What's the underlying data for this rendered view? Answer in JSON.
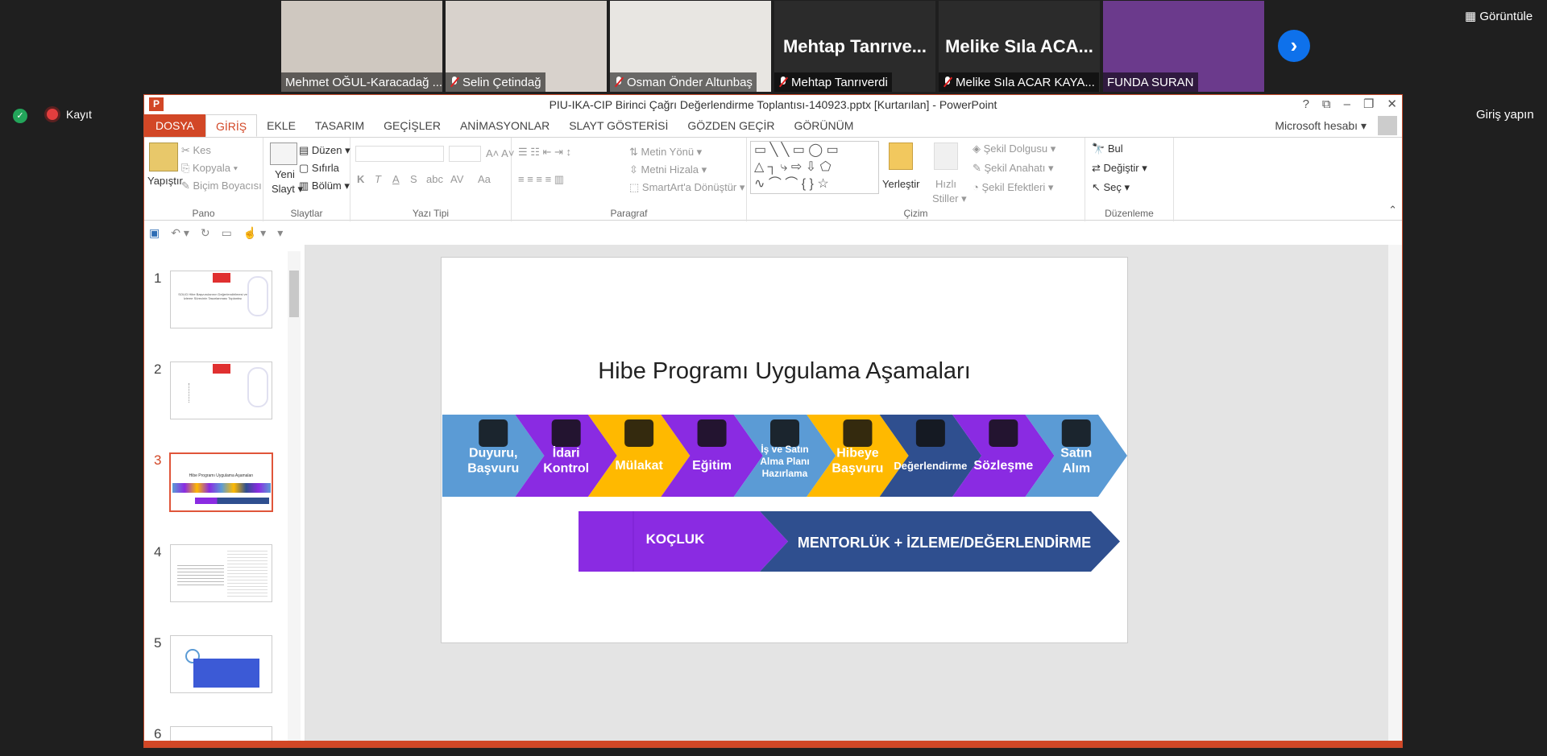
{
  "participants": [
    {
      "name": "Mehmet OĞUL-Karacadağ ...",
      "muted": false,
      "bg": "#cfc8c0"
    },
    {
      "name": "Selin Çetindağ",
      "muted": true,
      "bg": "#d8d2cc"
    },
    {
      "name": "Osman Önder Altunbaş",
      "muted": true,
      "bg": "#e8e6e2"
    },
    {
      "name": "Mehtap Tanrıverdi",
      "muted": true,
      "big": "Mehtap Tanrıve...",
      "bg": "#2b2b2b"
    },
    {
      "name": "Melike Sıla ACAR KAYA...",
      "muted": true,
      "big": "Melike Sıla ACA...",
      "bg": "#2b2b2b"
    },
    {
      "name": "FUNDA SURAN",
      "muted": false,
      "bg": "#6b3a8c"
    }
  ],
  "zoom": {
    "view_label": "Görüntüle",
    "record_label": "Kayıt",
    "signin_label": "Giriş yapın",
    "next_icon": "chevron-right-icon"
  },
  "window": {
    "title": "PIU-IKA-CIP Birinci Çağrı Değerlendirme Toplantısı-140923.pptx [Kurtarılan] - PowerPoint",
    "app_icon": "P",
    "account": "Microsoft hesabı"
  },
  "tabs": [
    "DOSYA",
    "GİRİŞ",
    "EKLE",
    "TASARIM",
    "GEÇİŞLER",
    "ANİMASYONLAR",
    "SLAYT GÖSTERİSİ",
    "GÖZDEN GEÇİR",
    "GÖRÜNÜM"
  ],
  "ribbon": {
    "pano": {
      "label": "Pano",
      "paste": "Yapıştır",
      "cut": "Kes",
      "copy": "Kopyala",
      "painter": "Biçim Boyacısı"
    },
    "slaytlar": {
      "label": "Slaytlar",
      "new": "Yeni",
      "new2": "Slayt",
      "layout": "Düzen",
      "reset": "Sıfırla",
      "section": "Bölüm"
    },
    "font": {
      "label": "Yazı Tipi",
      "bold": "K",
      "italic": "T",
      "underline": "A",
      "strike": "S",
      "shadow": "abc",
      "spacing": "AV",
      "case": "Aa"
    },
    "paragraph": {
      "label": "Paragraf",
      "textdir": "Metin Yönü",
      "align": "Metni Hizala",
      "smartart": "SmartArt'a Dönüştür"
    },
    "drawing": {
      "label": "Çizim",
      "arrange": "Yerleştir",
      "quick1": "Hızlı",
      "quick2": "Stiller",
      "fill": "Şekil Dolgusu",
      "outline": "Şekil Anahatı",
      "effects": "Şekil Efektleri"
    },
    "editing": {
      "label": "Düzenleme",
      "find": "Bul",
      "replace": "Değiştir",
      "select": "Seç"
    }
  },
  "slide_numbers": [
    "1",
    "2",
    "3",
    "4",
    "5",
    "6"
  ],
  "slide": {
    "title": "Hibe Programı Uygulama Aşamaları",
    "steps": [
      {
        "l1": "Duyuru,",
        "l2": "Başvuru",
        "l3": "",
        "color": "#5b9bd5",
        "icon": "megaphone-icon"
      },
      {
        "l1": "İdari",
        "l2": "Kontrol",
        "l3": "",
        "color": "#8a2be2",
        "icon": "lamp-icon"
      },
      {
        "l1": "Mülakat",
        "l2": "",
        "l3": "",
        "color": "#ffb900",
        "icon": "people-icon"
      },
      {
        "l1": "Eğitim",
        "l2": "",
        "l3": "",
        "color": "#8a2be2",
        "icon": "presenter-icon"
      },
      {
        "l1": "İş ve Satın",
        "l2": "Alma Planı",
        "l3": "Hazırlama",
        "color": "#5b9bd5",
        "icon": "document-icon"
      },
      {
        "l1": "Hibeye",
        "l2": "Başvuru",
        "l3": "",
        "color": "#ffb900",
        "icon": "pin-icon"
      },
      {
        "l1": "Değerlendirme",
        "l2": "",
        "l3": "",
        "color": "#2f4f8f",
        "icon": "scales-icon"
      },
      {
        "l1": "Sözleşme",
        "l2": "",
        "l3": "",
        "color": "#8a2be2",
        "icon": "target-icon"
      },
      {
        "l1": "Satın",
        "l2": "Alım",
        "l3": "",
        "color": "#5b9bd5",
        "icon": "growth-chart-icon"
      }
    ],
    "coaching": "KOÇLUK",
    "mentoring": "MENTORLÜK + İZLEME/DEĞERLENDİRME",
    "coaching_color": "#8a2be2",
    "mentoring_color": "#2f4f8f"
  },
  "thumbnails": {
    "t1_title": "SOLID Hibe Başvurularının Değerlendirilmesi ve İzleme Sürecinin Tasarlanması Toplantısı",
    "t3_title": "Hibe Programı Uygulama Aşamaları"
  }
}
